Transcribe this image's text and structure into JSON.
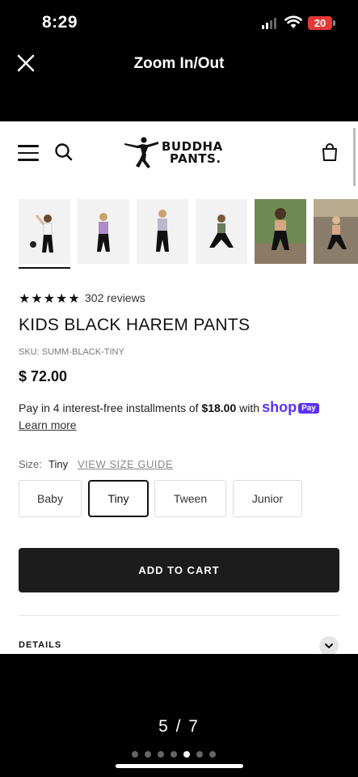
{
  "status": {
    "time": "8:29",
    "battery": "20"
  },
  "viewer": {
    "title": "Zoom In/Out",
    "pager": "5 / 7",
    "dot_count": 7,
    "active_dot": 4
  },
  "brand": {
    "line1": "BUDDHA",
    "line2": "PANTS."
  },
  "product": {
    "rating_stars": "★★★★★",
    "reviews": "302 reviews",
    "title": "KIDS BLACK HAREM PANTS",
    "sku": "SKU: SUMM-BLACK-TINY",
    "price": "$ 72.00",
    "installments_prefix": "Pay in 4 interest-free installments of",
    "installment_amount": "$18.00",
    "installments_with": "with",
    "shop_label": "shop",
    "pay_label": "Pay",
    "learn_more": "Learn more"
  },
  "size": {
    "label": "Size:",
    "selected": "Tiny",
    "guide": "VIEW SIZE GUIDE",
    "options": [
      "Baby",
      "Tiny",
      "Tween",
      "Junior"
    ]
  },
  "cta": {
    "add_to_cart": "ADD TO CART"
  },
  "sections": {
    "details": "DETAILS"
  },
  "colors": {
    "shop_purple": "#5a31f4",
    "button_dark": "#1c1c1c",
    "battery_red": "#e53935"
  }
}
